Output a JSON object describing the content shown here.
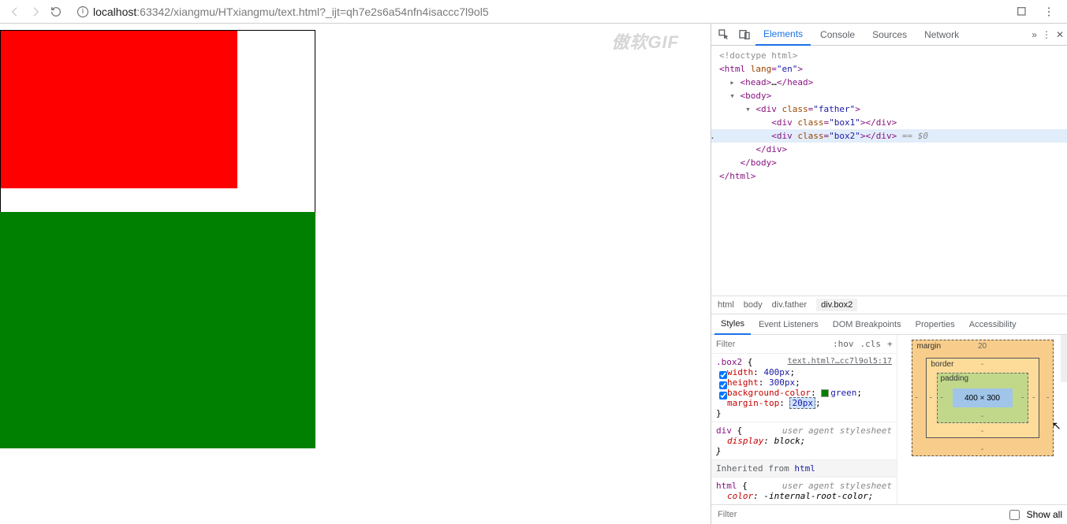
{
  "toolbar": {
    "url_host": "localhost",
    "url_port": ":63342",
    "url_path": "/xiangmu/HTxiangmu/text.html?_ijt=qh7e2s6a54nfn4isaccc7l9ol5"
  },
  "devtools": {
    "tabs": [
      "Elements",
      "Console",
      "Sources",
      "Network"
    ],
    "active_tab": "Elements",
    "dom": {
      "doctype": "<!doctype html>",
      "html_open": "<html lang=\"en\">",
      "head": "<head>…</head>",
      "body_open": "<body>",
      "father_open": "<div class=\"father\">",
      "box1": "<div class=\"box1\"></div>",
      "box2": "<div class=\"box2\"></div>",
      "eq_sel": " == $0",
      "father_close": "</div>",
      "body_close": "</body>",
      "html_close": "</html>"
    },
    "breadcrumb": [
      "html",
      "body",
      "div.father",
      "div.box2"
    ],
    "styles_tabs": [
      "Styles",
      "Event Listeners",
      "DOM Breakpoints",
      "Properties",
      "Accessibility"
    ],
    "active_styles_tab": "Styles",
    "filter_placeholder": "Filter",
    "hov_label": ":hov",
    "cls_label": ".cls",
    "rules": {
      "box2": {
        "selector": ".box2",
        "open_brace": " {",
        "source": "text.html?…cc7l9ol5:17",
        "decls": [
          {
            "prop": "width",
            "val": "400px",
            "checked": true
          },
          {
            "prop": "height",
            "val": "300px",
            "checked": true
          },
          {
            "prop": "background-color",
            "val": "green",
            "checked": true,
            "swatch": "#008000"
          },
          {
            "prop": "margin-top",
            "val": "20px",
            "checked": false,
            "editing": true
          }
        ],
        "close": "}"
      },
      "div": {
        "selector": "div",
        "open_brace": " {",
        "source": "user agent stylesheet",
        "decls": [
          {
            "prop": "display",
            "val": "block"
          }
        ],
        "close": "}"
      },
      "inherited": {
        "label": "Inherited from ",
        "from": "html"
      },
      "html": {
        "selector": "html",
        "open_brace": " {",
        "source": "user agent stylesheet",
        "partial": {
          "prop": "color",
          "val": "-internal-root-color;"
        }
      }
    },
    "box_model": {
      "margin_label": "margin",
      "margin_top": "20",
      "border_label": "border",
      "padding_label": "padding",
      "content": "400 × 300",
      "dash": "-"
    },
    "computed_filter_placeholder": "Filter",
    "show_all_label": "Show all"
  },
  "watermark": "傲软GIF"
}
